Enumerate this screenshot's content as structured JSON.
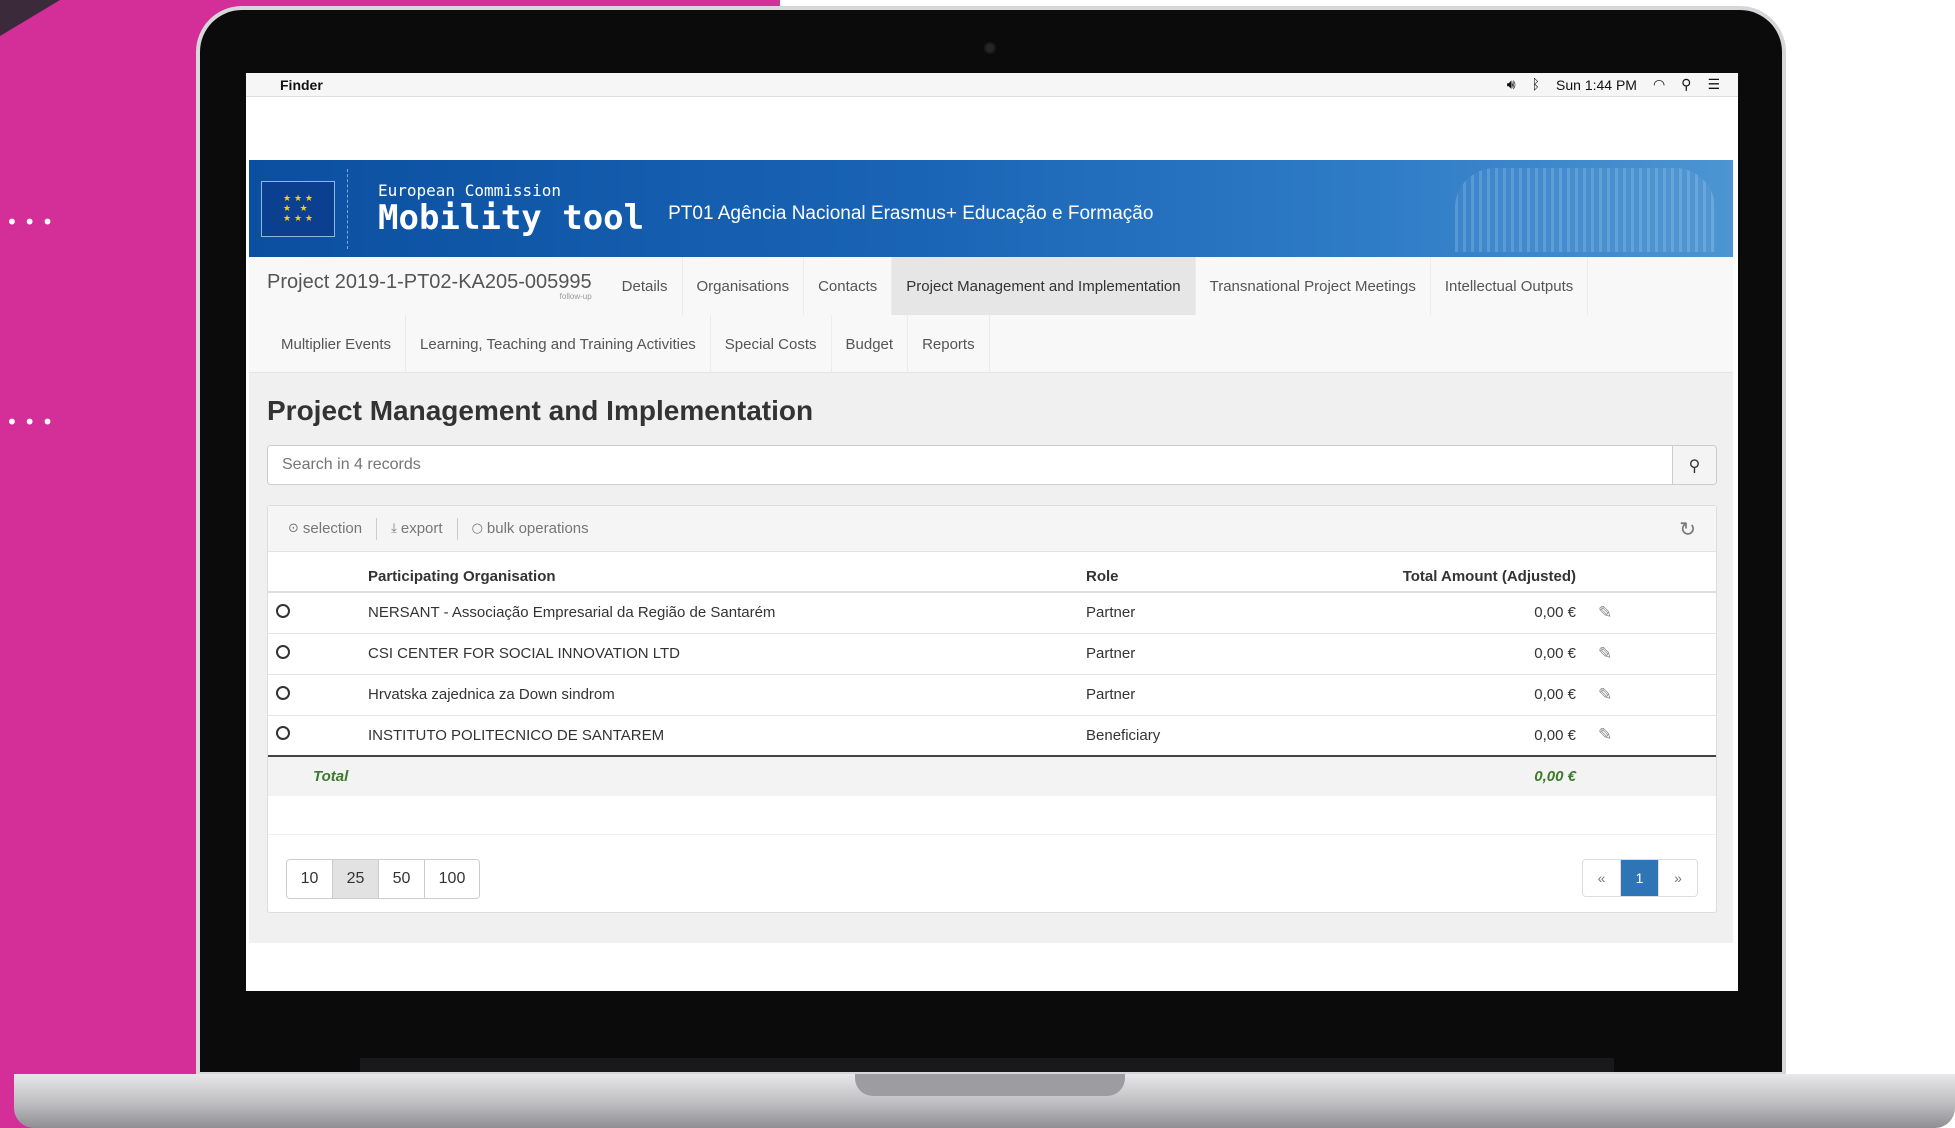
{
  "menubar": {
    "app_name": "Finder",
    "clock": "Sun 1:44 PM",
    "icons": [
      "apple-icon",
      "volume-icon",
      "bluetooth-icon",
      "wifi-icon",
      "spotlight-icon",
      "list-icon"
    ]
  },
  "header": {
    "line1": "European Commission",
    "line2": "Mobility tool",
    "agency": "PT01 Agência Nacional Erasmus+ Educação e Formação"
  },
  "project": {
    "id": "Project 2019-1-PT02-KA205-005995",
    "follow_up": "follow-up"
  },
  "tabs_row1": [
    {
      "label": "Details"
    },
    {
      "label": "Organisations"
    },
    {
      "label": "Contacts"
    },
    {
      "label": "Project Management and Implementation"
    },
    {
      "label": "Transnational Project Meetings"
    },
    {
      "label": "Intellectual Outputs"
    }
  ],
  "tabs_row2": [
    {
      "label": "Multiplier Events"
    },
    {
      "label": "Learning, Teaching and Training Activities"
    },
    {
      "label": "Special Costs"
    },
    {
      "label": "Budget"
    },
    {
      "label": "Reports"
    }
  ],
  "page_title": "Project Management and Implementation",
  "search": {
    "placeholder": "Search in 4 records"
  },
  "toolbar": {
    "selection": "selection",
    "export": "export",
    "bulk": "bulk operations"
  },
  "table": {
    "headers": {
      "org": "Participating Organisation",
      "role": "Role",
      "amount": "Total Amount (Adjusted)"
    },
    "rows": [
      {
        "org": "NERSANT - Associação Empresarial da Região de Santarém",
        "role": "Partner",
        "amount": "0,00 €"
      },
      {
        "org": "CSI CENTER FOR SOCIAL INNOVATION LTD",
        "role": "Partner",
        "amount": "0,00 €"
      },
      {
        "org": "Hrvatska zajednica za Down sindrom",
        "role": "Partner",
        "amount": "0,00 €"
      },
      {
        "org": "INSTITUTO POLITECNICO DE SANTAREM",
        "role": "Beneficiary",
        "amount": "0,00 €"
      }
    ],
    "total_label": "Total",
    "total_amount": "0,00 €"
  },
  "page_sizes": [
    "10",
    "25",
    "50",
    "100"
  ],
  "pager": {
    "prev": "«",
    "current": "1",
    "next": "»"
  },
  "colors": {
    "brand_magenta": "#d42e98",
    "ec_blue": "#0b4fa0",
    "pager_active": "#2f75b5",
    "total_green": "#3c7a2c"
  }
}
